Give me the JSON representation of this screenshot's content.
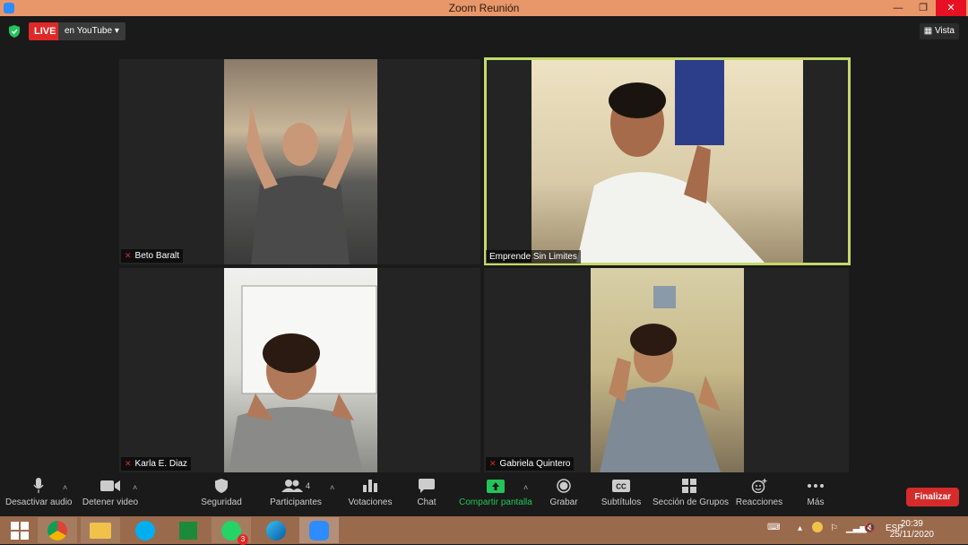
{
  "window": {
    "title": "Zoom Reunión",
    "minimize": "—",
    "restore": "❐",
    "close": "✕"
  },
  "topbar": {
    "live_badge": "LIVE",
    "stream_target": "en YouTube",
    "view_label": "Vista"
  },
  "participants": [
    {
      "name": "Beto Baralt",
      "muted": true
    },
    {
      "name": "Emprende Sin Limites",
      "muted": false,
      "active_speaker": true
    },
    {
      "name": "Karla E. Diaz",
      "muted": true
    },
    {
      "name": "Gabriela Quintero",
      "muted": true
    }
  ],
  "toolbar": {
    "mute_audio": "Desactivar audio",
    "stop_video": "Detener video",
    "security": "Seguridad",
    "participants": "Participantes",
    "participants_count": "4",
    "polls": "Votaciones",
    "chat": "Chat",
    "share_screen": "Compartir pantalla",
    "record": "Grabar",
    "subtitles": "Subtítulos",
    "breakout_rooms": "Sección de Grupos",
    "reactions": "Reacciones",
    "more": "Más",
    "end": "Finalizar"
  },
  "taskbar": {
    "apps": [
      "windows-start",
      "chrome",
      "file-explorer",
      "skype",
      "store",
      "whatsapp",
      "edge",
      "zoom"
    ],
    "whatsapp_badge": "3",
    "language": "ESP",
    "time": "20:39",
    "date": "25/11/2020"
  },
  "colors": {
    "accent_live": "#e02828",
    "active_speaker": "#c5d96a",
    "share_green": "#23c45a",
    "taskbar": "#9a6a4c",
    "titlebar": "#e8976a"
  }
}
